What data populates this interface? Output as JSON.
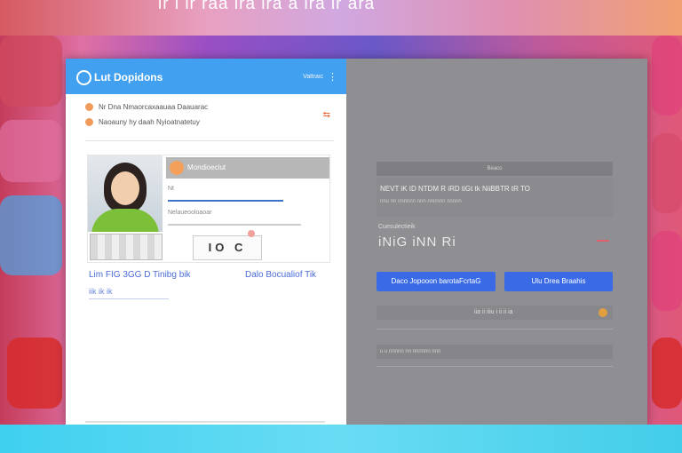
{
  "banner": {
    "title": "ir i ir raa ira ira a ira ir ara"
  },
  "app": {
    "title": "Lut Dopidons",
    "header_link": "Valtraic",
    "kebab": "⋮"
  },
  "notice": {
    "line1": "Nr Dna Nmaorcaxaauaa Daauarac",
    "line2": "Naoauny hy daah Nyioatnatetuy",
    "action": "⇆"
  },
  "profile": {
    "header_label": "Mondioeciut",
    "line1": "Nt",
    "line2": "Nelaueooloaoar",
    "captcha": "IO C"
  },
  "links": {
    "primary": "Lim FIG 3GG D Tinibg bik",
    "secondary": "Dalo Bocualiof Tik",
    "sub": "iik ik ik"
  },
  "right_panel": {
    "head": "Beaco",
    "block_text": "NEVT iK ID NTDM R iRD tiGt tk NiiBBTR tR TO",
    "block_sub": "nnu nn nnnnnn nnn nnnnnn nnnnn",
    "label": "Cuesulectieik",
    "big": "iNiG iNN Ri",
    "button_primary": "Daco Jopooon barotaFcrtaG",
    "button_secondary": "Ulu Drea Braahis",
    "row": "iia ii iiiu i ii ii ia",
    "foot": "u u nnnnn nn nnnnnn nnn"
  }
}
